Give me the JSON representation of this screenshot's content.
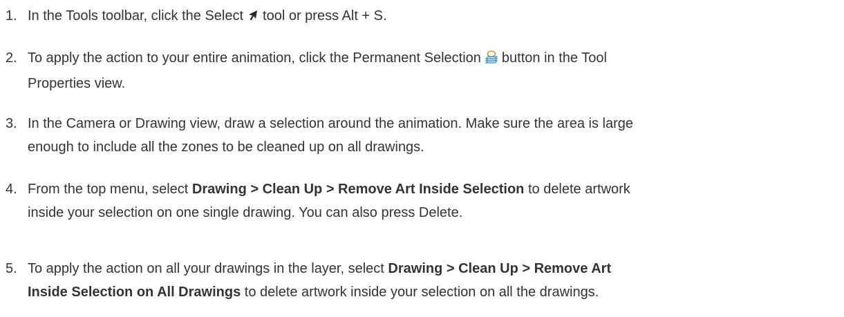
{
  "steps": [
    {
      "number": "1.",
      "line1_before": "In the Tools toolbar, click the Select",
      "line1_after": "tool or press Alt + S."
    },
    {
      "number": "2.",
      "line1_before": "To apply the action to your entire animation, click the Permanent Selection",
      "line1_after": "button in the Tool",
      "line2": "Properties view."
    },
    {
      "number": "3.",
      "line1": "In the Camera or Drawing view, draw a selection around the animation. Make sure the area is large",
      "line2": "enough to include all the zones to be cleaned up on all drawings."
    },
    {
      "number": "4.",
      "line1_before": "From the top menu, select",
      "line1_bold": "Drawing > Clean Up > Remove Art Inside Selection",
      "line1_after": "to delete artwork",
      "line2": "inside your selection on one single drawing. You can also press Delete."
    },
    {
      "number": "5.",
      "line1_before": "To apply the action on all your drawings in the layer, select",
      "line1_bold": "Drawing > Clean Up > Remove Art",
      "line2_bold": "Inside Selection on All Drawings",
      "line2_after": "to delete artwork inside your selection on all the drawings."
    }
  ],
  "icons": {
    "select": "select-arrow-icon",
    "permanent_selection": "permanent-selection-icon"
  }
}
